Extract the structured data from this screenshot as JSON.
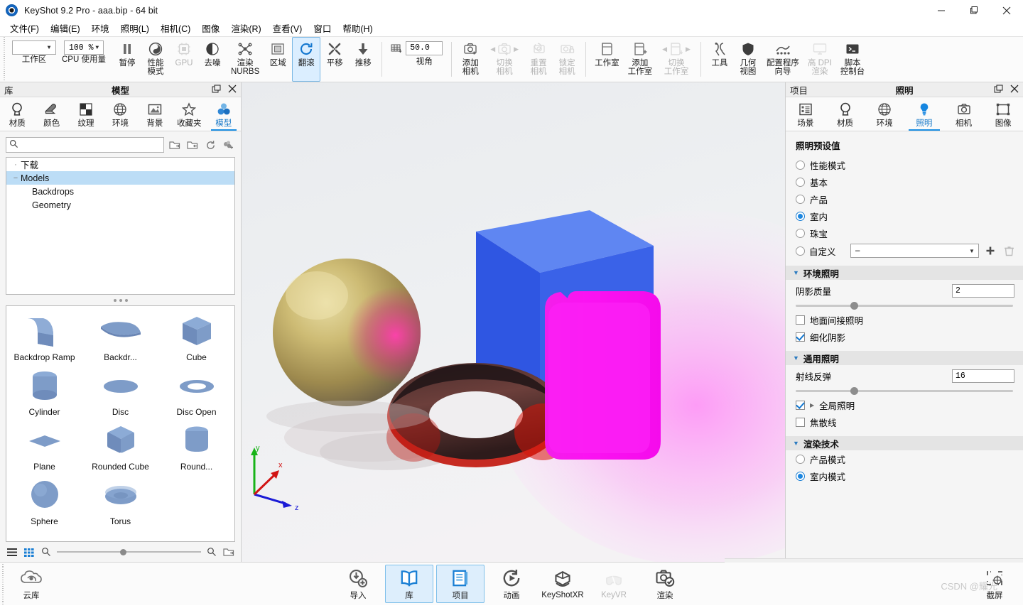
{
  "window": {
    "title": "KeyShot 9.2 Pro  - aaa.bip  - 64 bit",
    "minimize": "—",
    "maximize": "❐",
    "close": "✕"
  },
  "menubar": {
    "items": [
      {
        "label": "文件(F)"
      },
      {
        "label": "编辑(E)"
      },
      {
        "label": "环境"
      },
      {
        "label": "照明(L)"
      },
      {
        "label": "相机(C)"
      },
      {
        "label": "图像"
      },
      {
        "label": "渲染(R)"
      },
      {
        "label": "查看(V)"
      },
      {
        "label": "窗口"
      },
      {
        "label": "帮助(H)"
      }
    ]
  },
  "toolbar": {
    "workspace": {
      "label": "工作区",
      "value": ""
    },
    "cpu": {
      "label": "CPU 使用量",
      "value": "100 %"
    },
    "buttons": [
      {
        "name": "pause",
        "label": "暂停",
        "icon": "pause-icon",
        "state": "normal"
      },
      {
        "name": "performance-mode",
        "label": "性能\n模式",
        "icon": "performance-icon",
        "state": "normal"
      },
      {
        "name": "gpu",
        "label": "GPU",
        "icon": "gpu-icon",
        "state": "disabled"
      },
      {
        "name": "denoise",
        "label": "去噪",
        "icon": "denoise-icon",
        "state": "normal"
      },
      {
        "name": "render-nurbs",
        "label": "渲染\nNURBS",
        "icon": "nurbs-icon",
        "state": "normal"
      },
      {
        "name": "region",
        "label": "区域",
        "icon": "region-icon",
        "state": "normal"
      },
      {
        "name": "tumble",
        "label": "翻滚",
        "icon": "tumble-icon",
        "state": "active"
      },
      {
        "name": "pan",
        "label": "平移",
        "icon": "pan-icon",
        "state": "normal"
      },
      {
        "name": "dolly",
        "label": "推移",
        "icon": "dolly-icon",
        "state": "normal"
      }
    ],
    "fov": {
      "label": "视角",
      "value": "50.0",
      "icon": "grid-icon"
    },
    "camera_buttons": [
      {
        "name": "add-camera",
        "label": "添加\n相机",
        "icon": "add-camera-icon",
        "state": "normal"
      },
      {
        "name": "switch-camera",
        "label": "切换\n相机",
        "icon": "switch-camera-icon",
        "state": "disabled"
      },
      {
        "name": "reset-camera",
        "label": "重置\n相机",
        "icon": "reset-camera-icon",
        "state": "disabled"
      },
      {
        "name": "lock-camera",
        "label": "锁定\n相机",
        "icon": "lock-camera-icon",
        "state": "disabled"
      }
    ],
    "studio_buttons": [
      {
        "name": "studio",
        "label": "工作室",
        "icon": "studio-icon",
        "state": "normal"
      },
      {
        "name": "add-studio",
        "label": "添加\n工作室",
        "icon": "add-studio-icon",
        "state": "normal"
      },
      {
        "name": "switch-studio",
        "label": "切换\n工作室",
        "icon": "switch-studio-icon",
        "state": "disabled"
      }
    ],
    "tool_buttons": [
      {
        "name": "tools",
        "label": "工具",
        "icon": "tools-icon",
        "state": "normal"
      },
      {
        "name": "geometry-view",
        "label": "几何\n视图",
        "icon": "shield-icon",
        "state": "normal"
      },
      {
        "name": "configurator-wizard",
        "label": "配置程序\n向导",
        "icon": "configurator-icon",
        "state": "normal"
      },
      {
        "name": "high-dpi-render",
        "label": "高 DPI\n渲染",
        "icon": "monitor-icon",
        "state": "disabled"
      },
      {
        "name": "script-console",
        "label": "脚本\n控制台",
        "icon": "console-icon",
        "state": "normal"
      }
    ]
  },
  "library": {
    "header_left": "库",
    "header_title": "模型",
    "tabs": [
      {
        "name": "materials",
        "label": "材质",
        "icon": "material-icon",
        "selected": false
      },
      {
        "name": "colors",
        "label": "颜色",
        "icon": "color-icon",
        "selected": false
      },
      {
        "name": "textures",
        "label": "纹理",
        "icon": "texture-icon",
        "selected": false
      },
      {
        "name": "environments",
        "label": "环境",
        "icon": "globe-icon",
        "selected": false
      },
      {
        "name": "backgrounds",
        "label": "背景",
        "icon": "image-icon",
        "selected": false
      },
      {
        "name": "favorites",
        "label": "收藏夹",
        "icon": "star-icon",
        "selected": false
      },
      {
        "name": "models",
        "label": "模型",
        "icon": "models-icon",
        "selected": true
      }
    ],
    "search": {
      "placeholder": "",
      "value": "",
      "icon": "search-icon"
    },
    "search_tools": [
      {
        "name": "import-folder",
        "icon": "folder-import-icon"
      },
      {
        "name": "export-folder",
        "icon": "folder-export-icon"
      },
      {
        "name": "refresh",
        "icon": "refresh-icon"
      },
      {
        "name": "add-model",
        "icon": "add-model-icon"
      }
    ],
    "tree": [
      {
        "label": "下载",
        "depth": 0,
        "twisty": "·",
        "selected": false
      },
      {
        "label": "Models",
        "depth": 0,
        "twisty": "−",
        "selected": true
      },
      {
        "label": "Backdrops",
        "depth": 1,
        "twisty": "",
        "selected": false
      },
      {
        "label": "Geometry",
        "depth": 1,
        "twisty": "",
        "selected": false
      }
    ],
    "items": [
      {
        "label": "Backdrop Ramp",
        "shape": "backdrop-ramp"
      },
      {
        "label": "Backdr...",
        "shape": "backdrop-curve"
      },
      {
        "label": "Cube",
        "shape": "cube"
      },
      {
        "label": "Cylinder",
        "shape": "cylinder"
      },
      {
        "label": "Disc",
        "shape": "disc"
      },
      {
        "label": "Disc Open",
        "shape": "disc-open"
      },
      {
        "label": "Plane",
        "shape": "plane"
      },
      {
        "label": "Rounded Cube",
        "shape": "rounded-cube"
      },
      {
        "label": "Round...",
        "shape": "rounded-cylinder"
      },
      {
        "label": "Sphere",
        "shape": "sphere"
      },
      {
        "label": "Torus",
        "shape": "torus"
      }
    ],
    "footer": {
      "list_view": "list-view-icon",
      "grid_view": "grid-view-icon",
      "zoom_out": "zoom-out-icon",
      "zoom_in": "zoom-in-icon",
      "open_folder": "open-folder-icon"
    }
  },
  "viewport": {
    "axis": {
      "x": "x",
      "y": "y",
      "z": "z"
    },
    "scene_objects": [
      "gold-sphere",
      "blue-cube",
      "magenta-cylinder",
      "red-glass-torus"
    ],
    "colors": {
      "cube": "#3a62e8",
      "cube_top": "#5c82ef",
      "cube_side": "#3355e0",
      "cylinder": "#f713ef",
      "sphere": "#b99b54",
      "torus": "#5c3530",
      "floor": "#eceef0"
    }
  },
  "project": {
    "header_left": "项目",
    "header_title": "照明",
    "tabs": [
      {
        "name": "scene",
        "label": "场景",
        "icon": "scene-icon",
        "selected": false
      },
      {
        "name": "material",
        "label": "材质",
        "icon": "material-icon",
        "selected": false
      },
      {
        "name": "environment",
        "label": "环境",
        "icon": "globe-icon",
        "selected": false
      },
      {
        "name": "lighting",
        "label": "照明",
        "icon": "bulb-icon",
        "selected": true
      },
      {
        "name": "camera",
        "label": "相机",
        "icon": "camera-icon",
        "selected": false
      },
      {
        "name": "image",
        "label": "图像",
        "icon": "frame-icon",
        "selected": false
      }
    ],
    "presets_title": "照明预设值",
    "presets": [
      {
        "label": "性能模式",
        "selected": false
      },
      {
        "label": "基本",
        "selected": false
      },
      {
        "label": "产品",
        "selected": false
      },
      {
        "label": "室内",
        "selected": true
      },
      {
        "label": "珠宝",
        "selected": false
      },
      {
        "label": "自定义",
        "selected": false
      }
    ],
    "custom_dropdown": {
      "value": "–"
    },
    "custom_add_icon": "plus-icon",
    "custom_delete_icon": "trash-icon",
    "groups": [
      {
        "title": "环境照明",
        "param": {
          "label": "阴影质量",
          "value": "2",
          "slider_pct": 25
        },
        "checks": [
          {
            "label": "地面间接照明",
            "checked": false,
            "expandable": false
          },
          {
            "label": "细化阴影",
            "checked": true,
            "expandable": false
          }
        ]
      },
      {
        "title": "通用照明",
        "param": {
          "label": "射线反弹",
          "value": "16",
          "slider_pct": 25
        },
        "checks": [
          {
            "label": "全局照明",
            "checked": true,
            "expandable": true
          },
          {
            "label": "焦散线",
            "checked": false,
            "expandable": false
          }
        ]
      }
    ],
    "render_tech": {
      "title": "渲染技术",
      "options": [
        {
          "label": "产品模式",
          "selected": false
        },
        {
          "label": "室内模式",
          "selected": true
        }
      ]
    }
  },
  "bottombar": {
    "cloud": {
      "label": "云库",
      "icon": "cloud-icon"
    },
    "center": [
      {
        "name": "import",
        "label": "导入",
        "icon": "import-icon",
        "state": "normal"
      },
      {
        "name": "library",
        "label": "库",
        "icon": "book-icon",
        "state": "active"
      },
      {
        "name": "project",
        "label": "项目",
        "icon": "project-icon",
        "state": "active"
      },
      {
        "name": "animation",
        "label": "动画",
        "icon": "animation-icon",
        "state": "normal"
      },
      {
        "name": "keyshotxr",
        "label": "KeyShotXR",
        "icon": "keyshotxr-icon",
        "state": "normal"
      },
      {
        "name": "keyvr",
        "label": "KeyVR",
        "icon": "keyvr-icon",
        "state": "disabled"
      },
      {
        "name": "render",
        "label": "渲染",
        "icon": "render-icon",
        "state": "normal"
      }
    ],
    "screenshot": {
      "label": "截屏",
      "icon": "screenshot-icon"
    },
    "watermark": "CSDN @耀光"
  }
}
